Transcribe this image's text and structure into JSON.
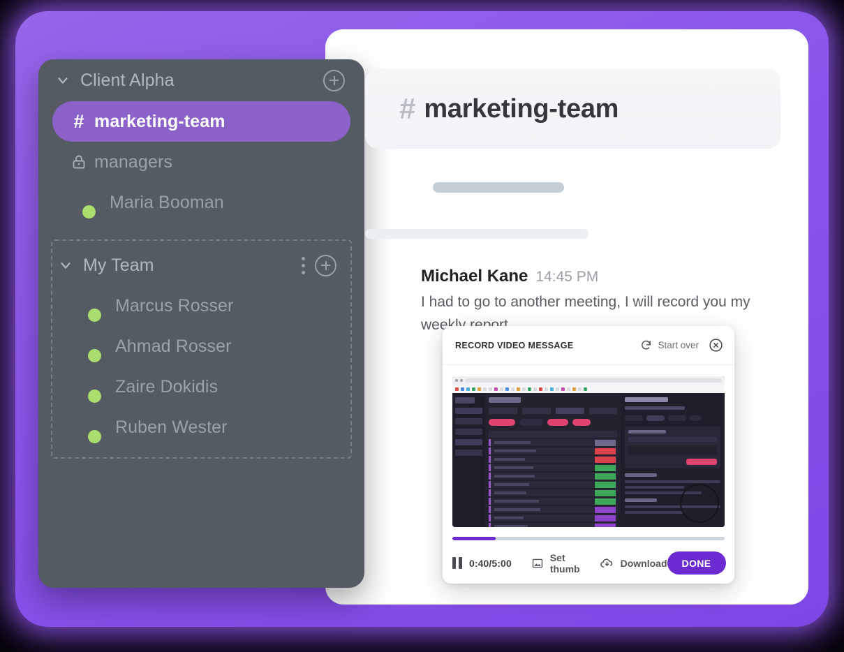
{
  "sidebar": {
    "groups": [
      {
        "name": "client-alpha",
        "title": "Client Alpha",
        "chevron_icon": "chevron-down-icon",
        "add_icon": "plus-circle-icon",
        "has_menu": false,
        "items": [
          {
            "type": "channel",
            "label": "marketing-team",
            "icon": "hash-icon",
            "active": true
          },
          {
            "type": "channel",
            "label": "managers",
            "icon": "lock-icon",
            "active": false
          },
          {
            "type": "person",
            "label": "Maria Booman",
            "icon": "avatar",
            "status": "online",
            "active": false
          }
        ]
      },
      {
        "name": "my-team",
        "title": "My Team",
        "chevron_icon": "chevron-down-icon",
        "add_icon": "plus-circle-icon",
        "menu_icon": "more-vertical-icon",
        "has_menu": true,
        "items": [
          {
            "type": "person",
            "label": "Marcus Rosser",
            "icon": "avatar",
            "status": "online",
            "active": false
          },
          {
            "type": "person",
            "label": "Ahmad Rosser",
            "icon": "avatar",
            "status": "online",
            "active": false
          },
          {
            "type": "person",
            "label": "Zaire Dokidis",
            "icon": "avatar",
            "status": "online",
            "active": false
          },
          {
            "type": "person",
            "label": "Ruben Wester",
            "icon": "avatar",
            "status": "online",
            "active": false
          }
        ]
      }
    ]
  },
  "main": {
    "channel": {
      "hash": "#",
      "name": "marketing-team"
    },
    "messages": [
      {
        "type": "placeholder",
        "author": "",
        "time": "",
        "text": ""
      },
      {
        "type": "message",
        "author": "Michael Kane",
        "time": "14:45 PM",
        "text": "I had to go to another meeting, I will record you my weekly report."
      }
    ]
  },
  "recorder": {
    "title": "RECORD VIDEO MESSAGE",
    "start_over_label": "Start over",
    "start_over_icon": "refresh-icon",
    "close_icon": "close-circle-icon",
    "progress_percent": 16,
    "pause_icon": "pause-icon",
    "time_label": "0:40/5:00",
    "set_thumb_label": "Set thumb",
    "set_thumb_icon": "image-icon",
    "download_label": "Download",
    "download_icon": "cloud-download-icon",
    "done_label": "DONE"
  },
  "colors": {
    "accent_glow": "#8a55ec",
    "accent_active_pill": "#8b62c9",
    "accent_button": "#6c2bd0",
    "sidebar_bg": "#555b63",
    "status_online": "#a9dd6e",
    "header_bg": "#f3f4f7",
    "progress_track": "#ccd4db"
  }
}
